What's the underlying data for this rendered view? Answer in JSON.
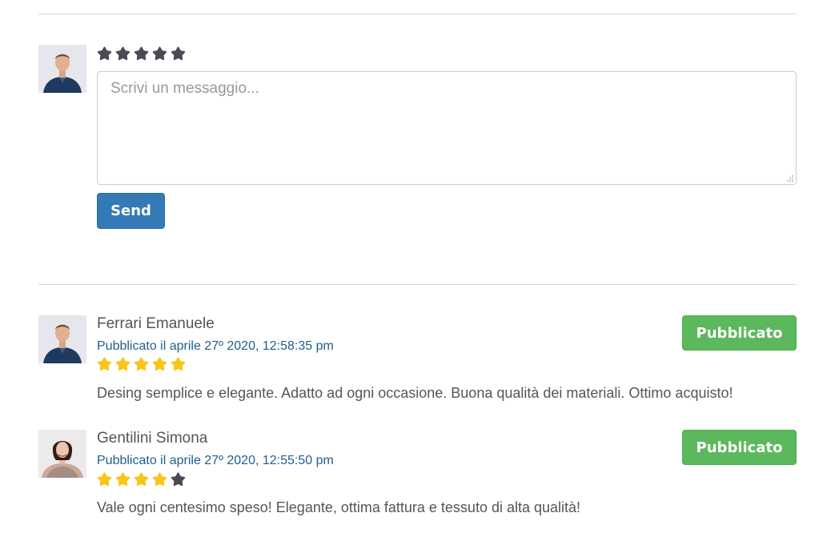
{
  "composer": {
    "rating": 0,
    "max_rating": 5,
    "placeholder": "Scrivi un messaggio...",
    "send_label": "Send"
  },
  "reviews": [
    {
      "author": "Ferrari Emanuele",
      "meta": "Pubblicato il aprile 27º 2020, 12:58:35 pm",
      "rating": 5,
      "text": "Desing semplice e elegante. Adatto ad ogni occasione. Buona qualità dei materiali. Ottimo acquisto!",
      "status": "Pubblicato",
      "avatar": "male-avatar"
    },
    {
      "author": "Gentilini Simona",
      "meta": "Pubblicato il aprile 27º 2020, 12:55:50 pm",
      "rating": 4,
      "text": "Vale ogni centesimo speso! Elegante, ottima fattura e tessuto di alta qualità!",
      "status": "Pubblicato",
      "avatar": "female-avatar"
    }
  ],
  "colors": {
    "star_filled": "#f8c51c",
    "star_empty": "#4a4a55",
    "primary": "#337ab7",
    "success": "#5cb85c",
    "meta_text": "#1f5f8b"
  }
}
